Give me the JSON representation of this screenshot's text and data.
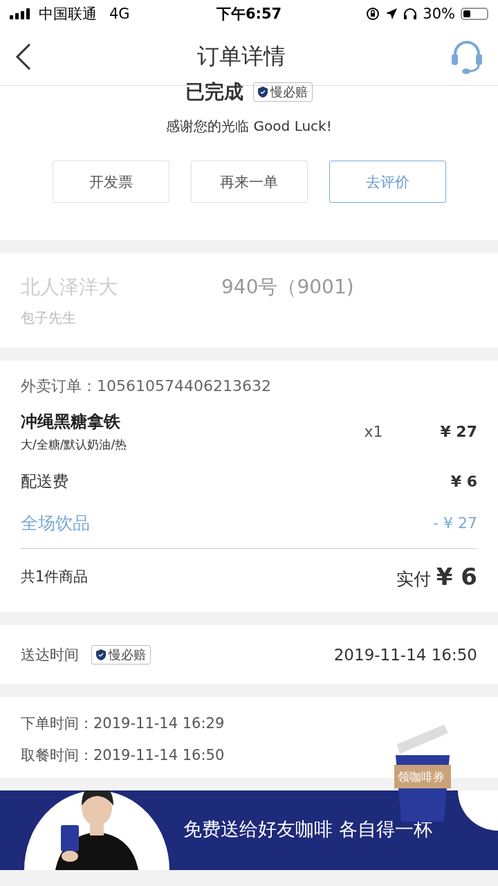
{
  "status_bar": {
    "carrier": "中国联通",
    "network": "4G",
    "time": "下午6:57",
    "battery": "30%"
  },
  "nav": {
    "title": "订单详情"
  },
  "order_status": {
    "title": "已完成",
    "badge": "慢必赔",
    "message": "感谢您的光临 Good Luck!"
  },
  "actions": [
    {
      "label": "开发票",
      "kind": "default"
    },
    {
      "label": "再来一单",
      "kind": "default"
    },
    {
      "label": "去评价",
      "kind": "primary"
    }
  ],
  "address": {
    "line_parts": [
      "北人泽洋大",
      "940号（9001)"
    ],
    "name": "包子先生"
  },
  "order": {
    "label": "外卖订单：",
    "number": "105610574406213632",
    "items": [
      {
        "name": "冲绳黑糖拿铁",
        "options": "大/全糖/默认奶油/热",
        "qty": "x1",
        "price": "¥ 27"
      }
    ],
    "fees": [
      {
        "label": "配送费",
        "amount": "¥ 6",
        "kind": "fee"
      },
      {
        "label": "全场饮品",
        "amount": "- ¥ 27",
        "kind": "discount"
      }
    ],
    "count": "共1件商品",
    "paid_label": "实付",
    "paid": "¥ 6"
  },
  "delivery": {
    "label": "送达时间",
    "badge": "慢必赔",
    "time": "2019-11-14 16:50"
  },
  "times": [
    {
      "label": "下单时间：",
      "value": "2019-11-14 16:29"
    },
    {
      "label": "取餐时间：",
      "value": "2019-11-14 16:50"
    }
  ],
  "promo": {
    "cup_label": "领咖啡券",
    "banner_text": "免费送给好友咖啡 各自得一杯"
  }
}
